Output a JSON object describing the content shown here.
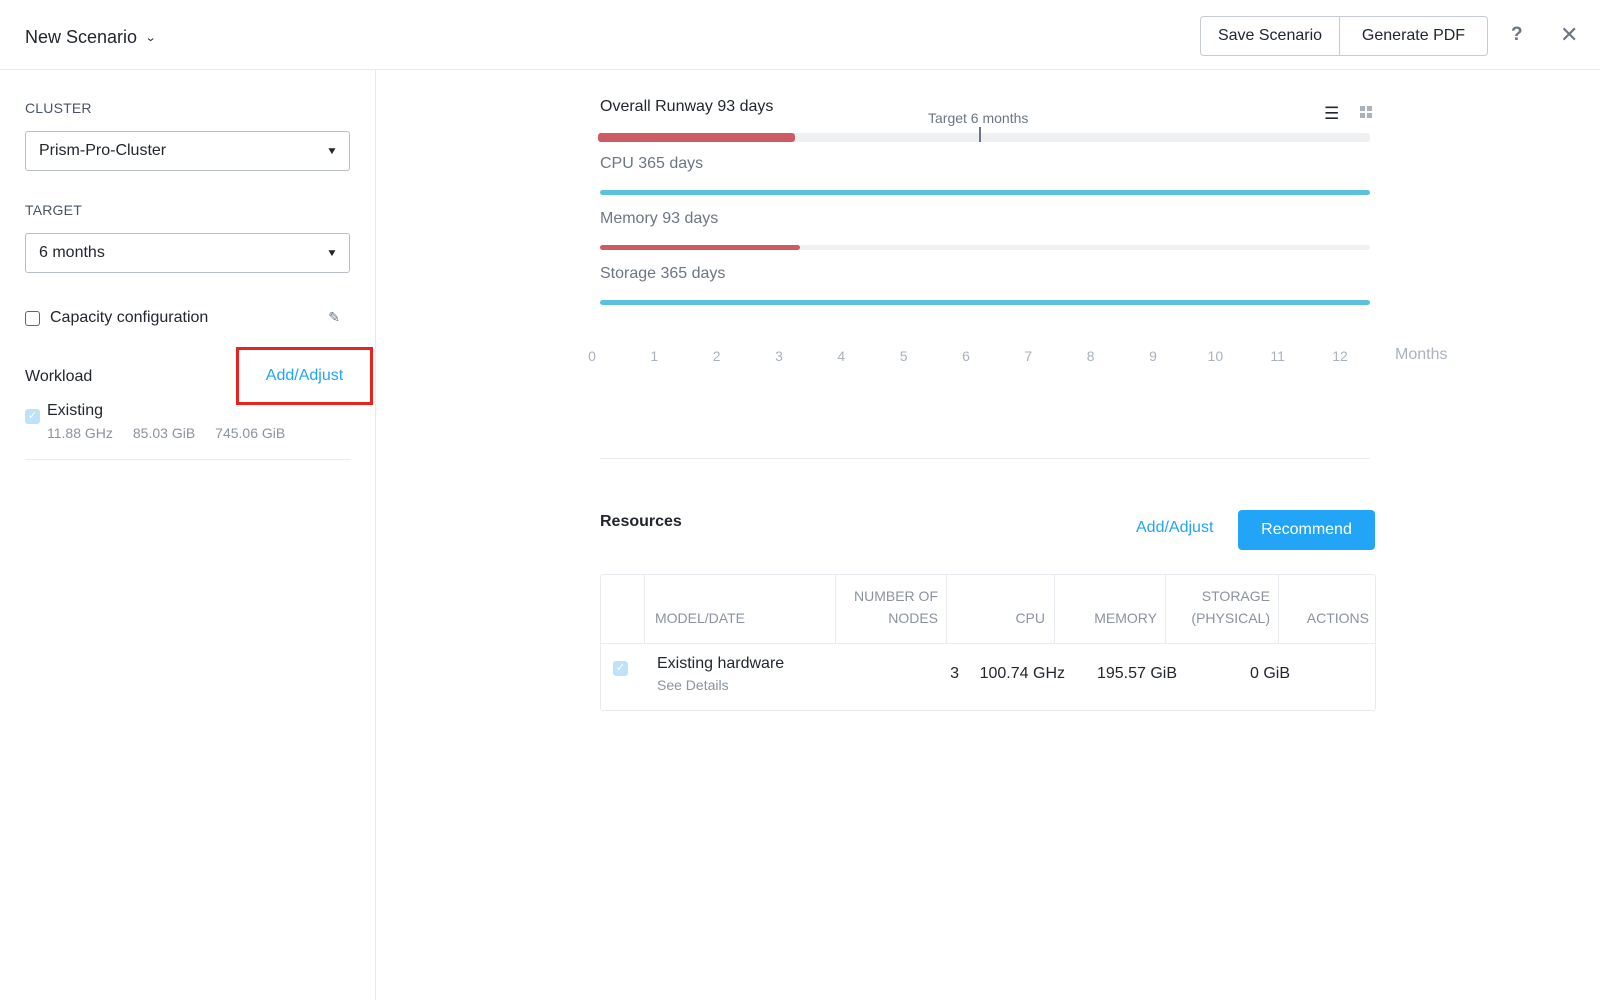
{
  "header": {
    "title": "New Scenario",
    "save_label": "Save Scenario",
    "pdf_label": "Generate PDF",
    "help_label": "?",
    "close_label": "✕"
  },
  "sidebar": {
    "cluster_label": "CLUSTER",
    "cluster_value": "Prism-Pro-Cluster",
    "target_label": "TARGET",
    "target_value": "6 months",
    "capacity_label": "Capacity configuration",
    "workload_label": "Workload",
    "add_adjust_label": "Add/Adjust",
    "existing": {
      "name": "Existing",
      "cpu": "11.88 GHz",
      "memory": "85.03 GiB",
      "storage": "745.06 GiB",
      "checked": true
    }
  },
  "runway": {
    "overall_label": "Overall Runway 93 days",
    "target_label": "Target 6 months",
    "overall_fraction": 0.255,
    "resources": [
      {
        "label": "CPU 365 days",
        "fraction": 1.0,
        "color": "#5bc1df"
      },
      {
        "label": "Memory 93 days",
        "fraction": 0.26,
        "color": "#cd5c62"
      },
      {
        "label": "Storage 365 days",
        "fraction": 1.0,
        "color": "#5bc1df"
      }
    ],
    "overall_color": "#cd5c62",
    "axis_ticks": [
      "0",
      "1",
      "2",
      "3",
      "4",
      "5",
      "6",
      "7",
      "8",
      "9",
      "10",
      "11",
      "12"
    ],
    "axis_unit": "Months"
  },
  "resources": {
    "title": "Resources",
    "add_adjust_label": "Add/Adjust",
    "recommend_label": "Recommend",
    "columns": {
      "model": "MODEL/DATE",
      "nodes_1": "NUMBER OF",
      "nodes_2": "NODES",
      "cpu": "CPU",
      "memory": "MEMORY",
      "storage_1": "STORAGE",
      "storage_2": "(PHYSICAL)",
      "actions": "ACTIONS"
    },
    "rows": [
      {
        "name": "Existing hardware",
        "details": "See Details",
        "nodes": "3",
        "cpu": "100.74 GHz",
        "memory": "195.57 GiB",
        "storage": "0 GiB",
        "checked": true
      }
    ]
  }
}
